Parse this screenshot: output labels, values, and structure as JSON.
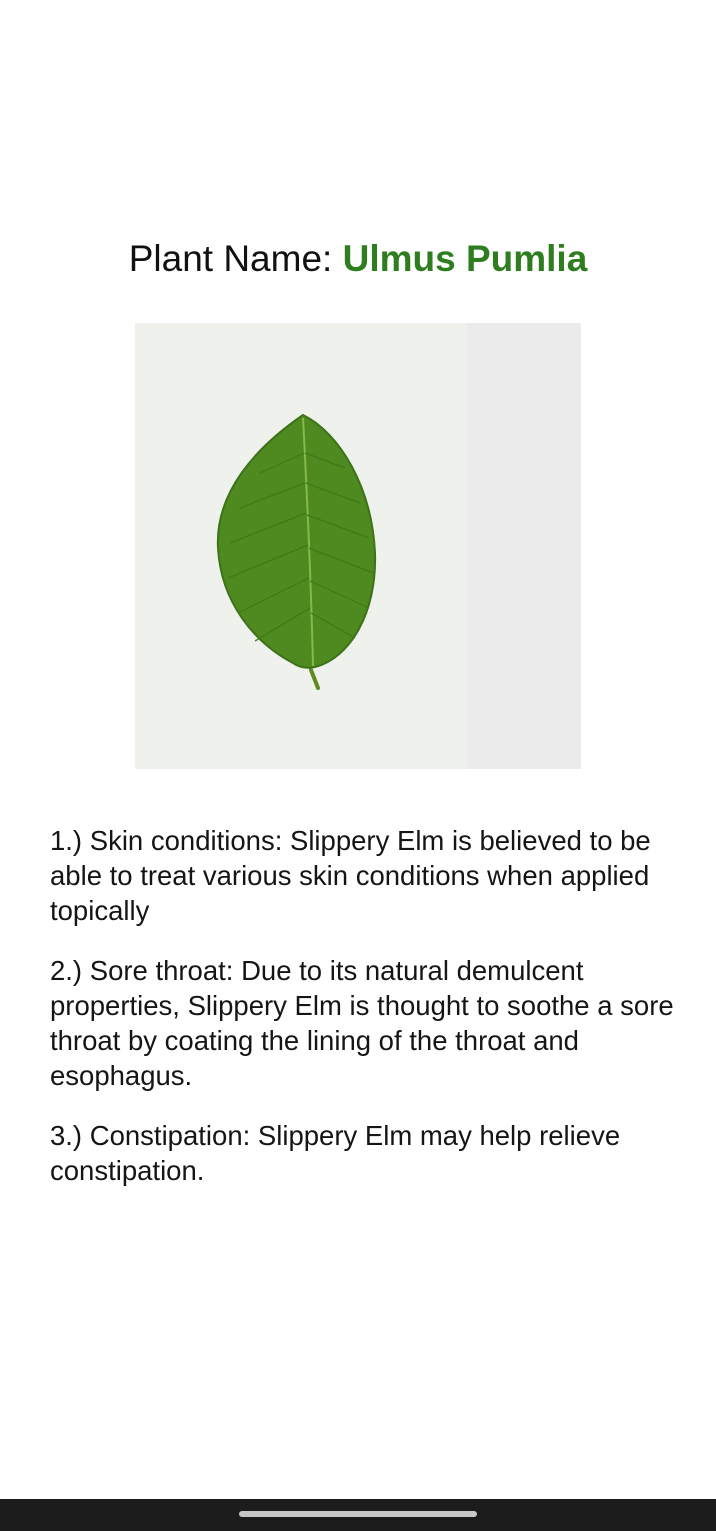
{
  "header": {
    "prefix": "Plant Name: ",
    "plant_name": "Ulmus Pumlia",
    "accent_color": "#2e7d1f"
  },
  "image": {
    "subject": "leaf-photo"
  },
  "uses": [
    "1.) Skin conditions: Slippery Elm is believed to be able to treat various skin conditions when applied topically",
    "2.) Sore throat: Due to its natural demulcent properties, Slippery Elm is thought to soothe a sore throat by coating the lining of the throat and esophagus.",
    "3.) Constipation: Slippery Elm may help relieve constipation."
  ],
  "system": {
    "nav_bar_color": "#1c1c1c"
  }
}
